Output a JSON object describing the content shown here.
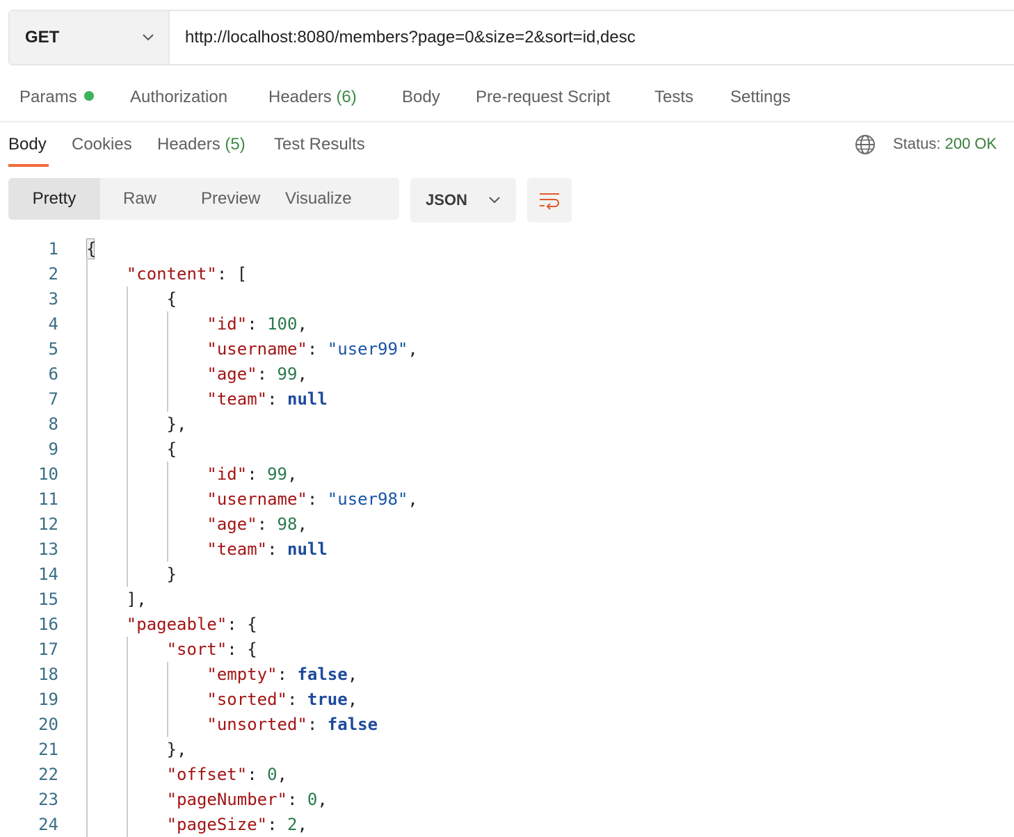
{
  "request": {
    "method": "GET",
    "url": "http://localhost:8080/members?page=0&size=2&sort=id,desc"
  },
  "request_tabs": {
    "params": "Params",
    "authorization": "Authorization",
    "headers": "Headers",
    "headers_count": "(6)",
    "body": "Body",
    "prerequest": "Pre-request Script",
    "tests": "Tests",
    "settings": "Settings"
  },
  "response_tabs": {
    "body": "Body",
    "cookies": "Cookies",
    "headers": "Headers",
    "headers_count": "(5)",
    "test_results": "Test Results",
    "status_label": "Status:",
    "status_value": "200 OK"
  },
  "view_modes": {
    "pretty": "Pretty",
    "raw": "Raw",
    "preview": "Preview",
    "visualize": "Visualize"
  },
  "format": {
    "selected": "JSON"
  },
  "code_lines": [
    [
      [
        "p",
        "{"
      ]
    ],
    [
      [
        "p",
        "    "
      ],
      [
        "k",
        "\"content\""
      ],
      [
        "p",
        ": ["
      ]
    ],
    [
      [
        "p",
        "        {"
      ]
    ],
    [
      [
        "p",
        "            "
      ],
      [
        "k",
        "\"id\""
      ],
      [
        "p",
        ": "
      ],
      [
        "n",
        "100"
      ],
      [
        "p",
        ","
      ]
    ],
    [
      [
        "p",
        "            "
      ],
      [
        "k",
        "\"username\""
      ],
      [
        "p",
        ": "
      ],
      [
        "s",
        "\"user99\""
      ],
      [
        "p",
        ","
      ]
    ],
    [
      [
        "p",
        "            "
      ],
      [
        "k",
        "\"age\""
      ],
      [
        "p",
        ": "
      ],
      [
        "n",
        "99"
      ],
      [
        "p",
        ","
      ]
    ],
    [
      [
        "p",
        "            "
      ],
      [
        "k",
        "\"team\""
      ],
      [
        "p",
        ": "
      ],
      [
        "kw",
        "null"
      ]
    ],
    [
      [
        "p",
        "        },"
      ]
    ],
    [
      [
        "p",
        "        {"
      ]
    ],
    [
      [
        "p",
        "            "
      ],
      [
        "k",
        "\"id\""
      ],
      [
        "p",
        ": "
      ],
      [
        "n",
        "99"
      ],
      [
        "p",
        ","
      ]
    ],
    [
      [
        "p",
        "            "
      ],
      [
        "k",
        "\"username\""
      ],
      [
        "p",
        ": "
      ],
      [
        "s",
        "\"user98\""
      ],
      [
        "p",
        ","
      ]
    ],
    [
      [
        "p",
        "            "
      ],
      [
        "k",
        "\"age\""
      ],
      [
        "p",
        ": "
      ],
      [
        "n",
        "98"
      ],
      [
        "p",
        ","
      ]
    ],
    [
      [
        "p",
        "            "
      ],
      [
        "k",
        "\"team\""
      ],
      [
        "p",
        ": "
      ],
      [
        "kw",
        "null"
      ]
    ],
    [
      [
        "p",
        "        }"
      ]
    ],
    [
      [
        "p",
        "    ],"
      ]
    ],
    [
      [
        "p",
        "    "
      ],
      [
        "k",
        "\"pageable\""
      ],
      [
        "p",
        ": {"
      ]
    ],
    [
      [
        "p",
        "        "
      ],
      [
        "k",
        "\"sort\""
      ],
      [
        "p",
        ": {"
      ]
    ],
    [
      [
        "p",
        "            "
      ],
      [
        "k",
        "\"empty\""
      ],
      [
        "p",
        ": "
      ],
      [
        "kw",
        "false"
      ],
      [
        "p",
        ","
      ]
    ],
    [
      [
        "p",
        "            "
      ],
      [
        "k",
        "\"sorted\""
      ],
      [
        "p",
        ": "
      ],
      [
        "kw",
        "true"
      ],
      [
        "p",
        ","
      ]
    ],
    [
      [
        "p",
        "            "
      ],
      [
        "k",
        "\"unsorted\""
      ],
      [
        "p",
        ": "
      ],
      [
        "kw",
        "false"
      ]
    ],
    [
      [
        "p",
        "        },"
      ]
    ],
    [
      [
        "p",
        "        "
      ],
      [
        "k",
        "\"offset\""
      ],
      [
        "p",
        ": "
      ],
      [
        "n",
        "0"
      ],
      [
        "p",
        ","
      ]
    ],
    [
      [
        "p",
        "        "
      ],
      [
        "k",
        "\"pageNumber\""
      ],
      [
        "p",
        ": "
      ],
      [
        "n",
        "0"
      ],
      [
        "p",
        ","
      ]
    ],
    [
      [
        "p",
        "        "
      ],
      [
        "k",
        "\"pageSize\""
      ],
      [
        "p",
        ": "
      ],
      [
        "n",
        "2"
      ],
      [
        "p",
        ","
      ]
    ]
  ]
}
